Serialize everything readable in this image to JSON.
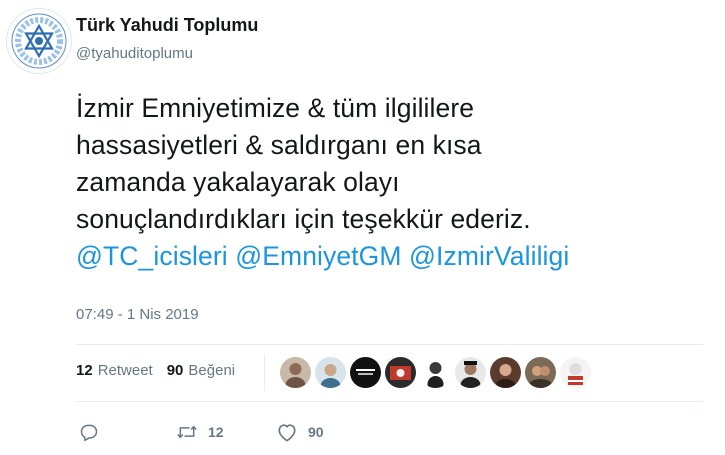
{
  "author": {
    "display_name": "Türk Yahudi Toplumu",
    "handle": "@tyahuditoplumu"
  },
  "tweet": {
    "lines": [
      "İzmir Emniyetimize & tüm ilgililere",
      "hassasiyetleri & saldırganı en kısa",
      "zamanda yakalayarak olayı",
      "sonuçlandırdıkları için teşekkür ederiz."
    ],
    "mentions": [
      "@TC_icisleri",
      "@EmniyetGM",
      "@IzmirValiligi"
    ],
    "timestamp": "07:49 - 1 Nis 2019"
  },
  "stats": {
    "retweet_count": "12",
    "retweet_label": "Retweet",
    "like_count": "90",
    "like_label": "Beğeni"
  },
  "actions": {
    "reply_icon": "reply-icon",
    "retweet_icon": "retweet-icon",
    "retweet_count": "12",
    "like_icon": "heart-icon",
    "like_count": "90"
  },
  "colors": {
    "mention": "#1b95e0",
    "secondary_text": "#657786",
    "primary_text": "#14171a",
    "divider": "#e6ecf0"
  }
}
